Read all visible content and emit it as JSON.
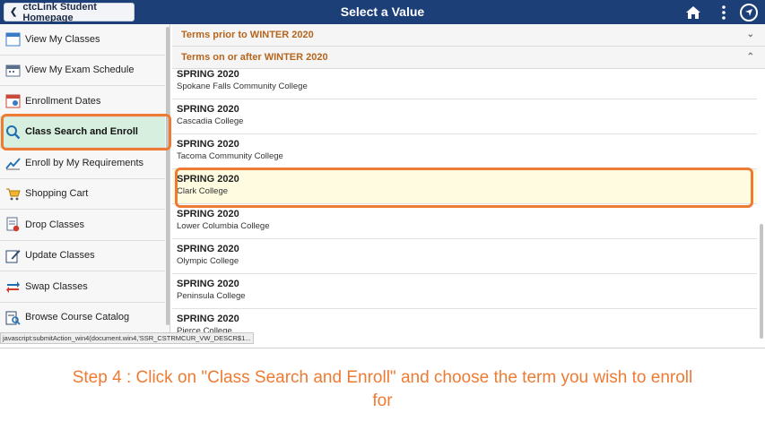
{
  "header": {
    "back_label": "ctcLink Student Homepage",
    "title": "Select a Value",
    "icons": [
      "home-icon",
      "more-vertical-icon",
      "navigation-icon"
    ]
  },
  "sidebar": {
    "items": [
      {
        "label": "View My Classes",
        "icon": "calendar-icon"
      },
      {
        "label": "View My Exam Schedule",
        "icon": "exam-calendar-icon"
      },
      {
        "label": "Enrollment Dates",
        "icon": "enrollment-calendar-icon"
      },
      {
        "label": "Class Search and Enroll",
        "icon": "search-icon",
        "active": true
      },
      {
        "label": "Enroll by My Requirements",
        "icon": "chart-line-icon"
      },
      {
        "label": "Shopping Cart",
        "icon": "cart-icon"
      },
      {
        "label": "Drop Classes",
        "icon": "drop-icon"
      },
      {
        "label": "Update Classes",
        "icon": "edit-icon"
      },
      {
        "label": "Swap Classes",
        "icon": "swap-icon"
      },
      {
        "label": "Browse Course Catalog",
        "icon": "catalog-icon"
      }
    ]
  },
  "groups": {
    "prior": "Terms prior to WINTER 2020",
    "after": "Terms on or after WINTER 2020"
  },
  "terms": [
    {
      "term": "SPRING 2020",
      "college": "Spokane Falls Community College"
    },
    {
      "term": "SPRING 2020",
      "college": "Cascadia College"
    },
    {
      "term": "SPRING 2020",
      "college": "Tacoma Community College"
    },
    {
      "term": "SPRING 2020",
      "college": "Clark College",
      "selected": true
    },
    {
      "term": "SPRING 2020",
      "college": "Lower Columbia College"
    },
    {
      "term": "SPRING 2020",
      "college": "Olympic College"
    },
    {
      "term": "SPRING 2020",
      "college": "Peninsula College"
    },
    {
      "term": "SPRING 2020",
      "college": "Pierce College"
    }
  ],
  "status_bar": "javascript:submitAction_win4(document.win4,'SSR_CSTRMCUR_VW_DESCR$1...",
  "caption": "Step 4 : Click on \"Class Search and Enroll\" and choose the term you wish to enroll for",
  "colors": {
    "header_bg": "#1c3f78",
    "accent_orange": "#ee7b33",
    "group_text": "#b5651d",
    "active_item_bg": "#d6efdf",
    "selected_term_bg": "#fffbe0"
  }
}
